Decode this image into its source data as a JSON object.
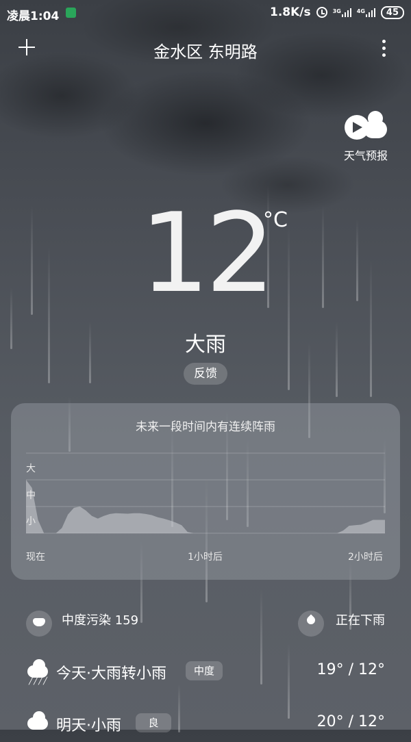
{
  "status_bar": {
    "time": "凌晨1:04",
    "net_speed": "1.8K/s",
    "net1": "3G",
    "net2": "4G",
    "battery": "45"
  },
  "header": {
    "location": "金水区 东明路"
  },
  "video_forecast": {
    "label": "天气预报"
  },
  "current": {
    "temperature": "12",
    "unit": "°C",
    "condition": "大雨",
    "feedback_label": "反馈"
  },
  "rain_card": {
    "title": "未来一段时间内有连续阵雨",
    "y_labels": [
      "大",
      "中",
      "小"
    ],
    "x_labels": [
      "现在",
      "1小时后",
      "2小时后"
    ]
  },
  "chart_data": {
    "type": "area",
    "x": [
      0,
      2,
      4,
      6,
      8,
      10,
      12,
      14,
      16,
      18,
      20,
      22,
      24,
      26,
      28,
      30,
      32,
      34,
      36,
      38,
      40,
      42,
      44,
      46,
      48,
      50,
      52,
      54,
      56,
      58,
      60,
      62,
      64,
      66,
      68,
      70,
      72,
      74,
      76,
      78,
      80,
      82,
      84,
      86,
      88,
      90,
      92,
      94,
      96,
      98,
      100,
      102,
      104,
      106,
      108,
      110,
      112,
      114,
      116,
      118,
      120
    ],
    "values": [
      2.0,
      1.7,
      0.5,
      0.0,
      0.0,
      0.0,
      0.2,
      0.7,
      0.95,
      1.0,
      0.85,
      0.65,
      0.55,
      0.65,
      0.72,
      0.75,
      0.74,
      0.73,
      0.75,
      0.75,
      0.72,
      0.68,
      0.6,
      0.55,
      0.48,
      0.4,
      0.3,
      0.05,
      0.0,
      0.0,
      0.0,
      0.0,
      0.0,
      0.0,
      0.0,
      0.0,
      0.0,
      0.0,
      0.0,
      0.0,
      0.0,
      0.0,
      0.0,
      0.0,
      0.0,
      0.0,
      0.0,
      0.0,
      0.0,
      0.0,
      0.0,
      0.0,
      0.0,
      0.1,
      0.28,
      0.3,
      0.32,
      0.4,
      0.5,
      0.5,
      0.5
    ],
    "ylim": [
      0,
      3
    ],
    "y_tick_labels": [
      "小",
      "中",
      "大"
    ],
    "x_tick_labels": [
      "现在",
      "1小时后",
      "2小时后"
    ],
    "grid": true
  },
  "air_quality": {
    "label": "中度污染 159"
  },
  "now_status": {
    "label": "正在下雨"
  },
  "days": [
    {
      "label": "今天·大雨转小雨",
      "aqi": "中度",
      "range": "19° / 12°"
    },
    {
      "label": "明天·小雨",
      "aqi": "良",
      "range": "20° / 12°"
    }
  ],
  "icons": {
    "add": "plus-icon",
    "more": "more-vertical-icon",
    "video": "video-play-icon",
    "aqi": "mask-icon",
    "rain": "drop-icon"
  }
}
